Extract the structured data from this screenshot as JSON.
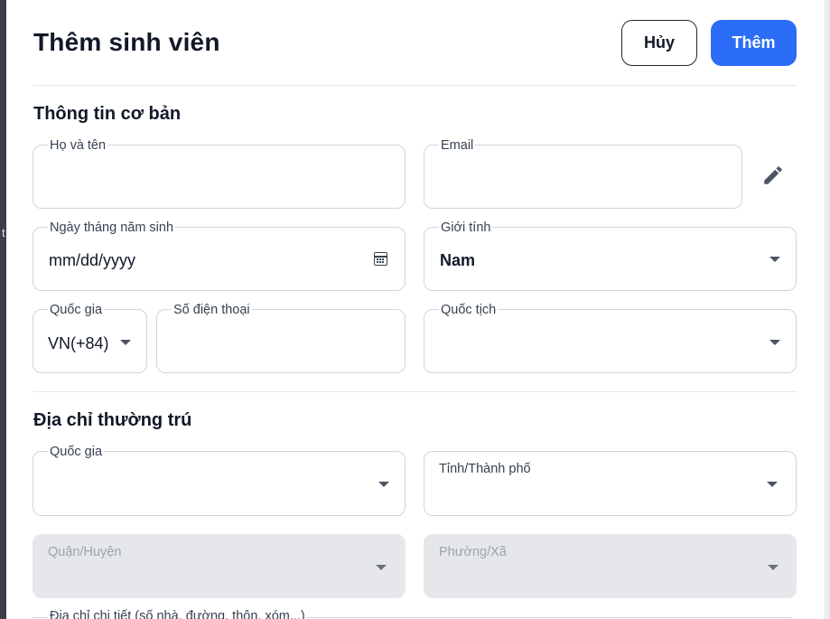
{
  "backdrop": {
    "glyph": "t"
  },
  "header": {
    "title": "Thêm sinh viên",
    "cancel_label": "Hủy",
    "add_label": "Thêm"
  },
  "basic": {
    "section_title": "Thông tin cơ bản",
    "full_name": {
      "label": "Họ và tên",
      "value": ""
    },
    "email": {
      "label": "Email",
      "value": ""
    },
    "dob": {
      "label": "Ngày tháng năm sinh",
      "value": "mm/dd/yyyy"
    },
    "gender": {
      "label": "Giới tính",
      "value": "Nam"
    },
    "country_code": {
      "label": "Quốc gia",
      "value": "VN(+84)"
    },
    "phone": {
      "label": "Số điện thoại",
      "value": ""
    },
    "nationality": {
      "label": "Quốc tịch",
      "value": ""
    }
  },
  "address": {
    "section_title": "Địa chỉ thường trú",
    "country": {
      "label": "Quốc gia",
      "value": ""
    },
    "province": {
      "label": "Tỉnh/Thành phố",
      "value": ""
    },
    "district": {
      "label": "Quận/Huyện",
      "value": ""
    },
    "ward": {
      "label": "Phường/Xã",
      "value": ""
    },
    "detail": {
      "label": "Địa chỉ chi tiết (số nhà, đường, thôn, xóm...)"
    }
  },
  "colors": {
    "primary": "#2b6df6",
    "border": "#d1d5db",
    "disabled": "#e5e7eb"
  },
  "icons": {
    "edit": "pencil-icon",
    "calendar": "calendar-icon",
    "dropdown": "caret-down-icon"
  }
}
